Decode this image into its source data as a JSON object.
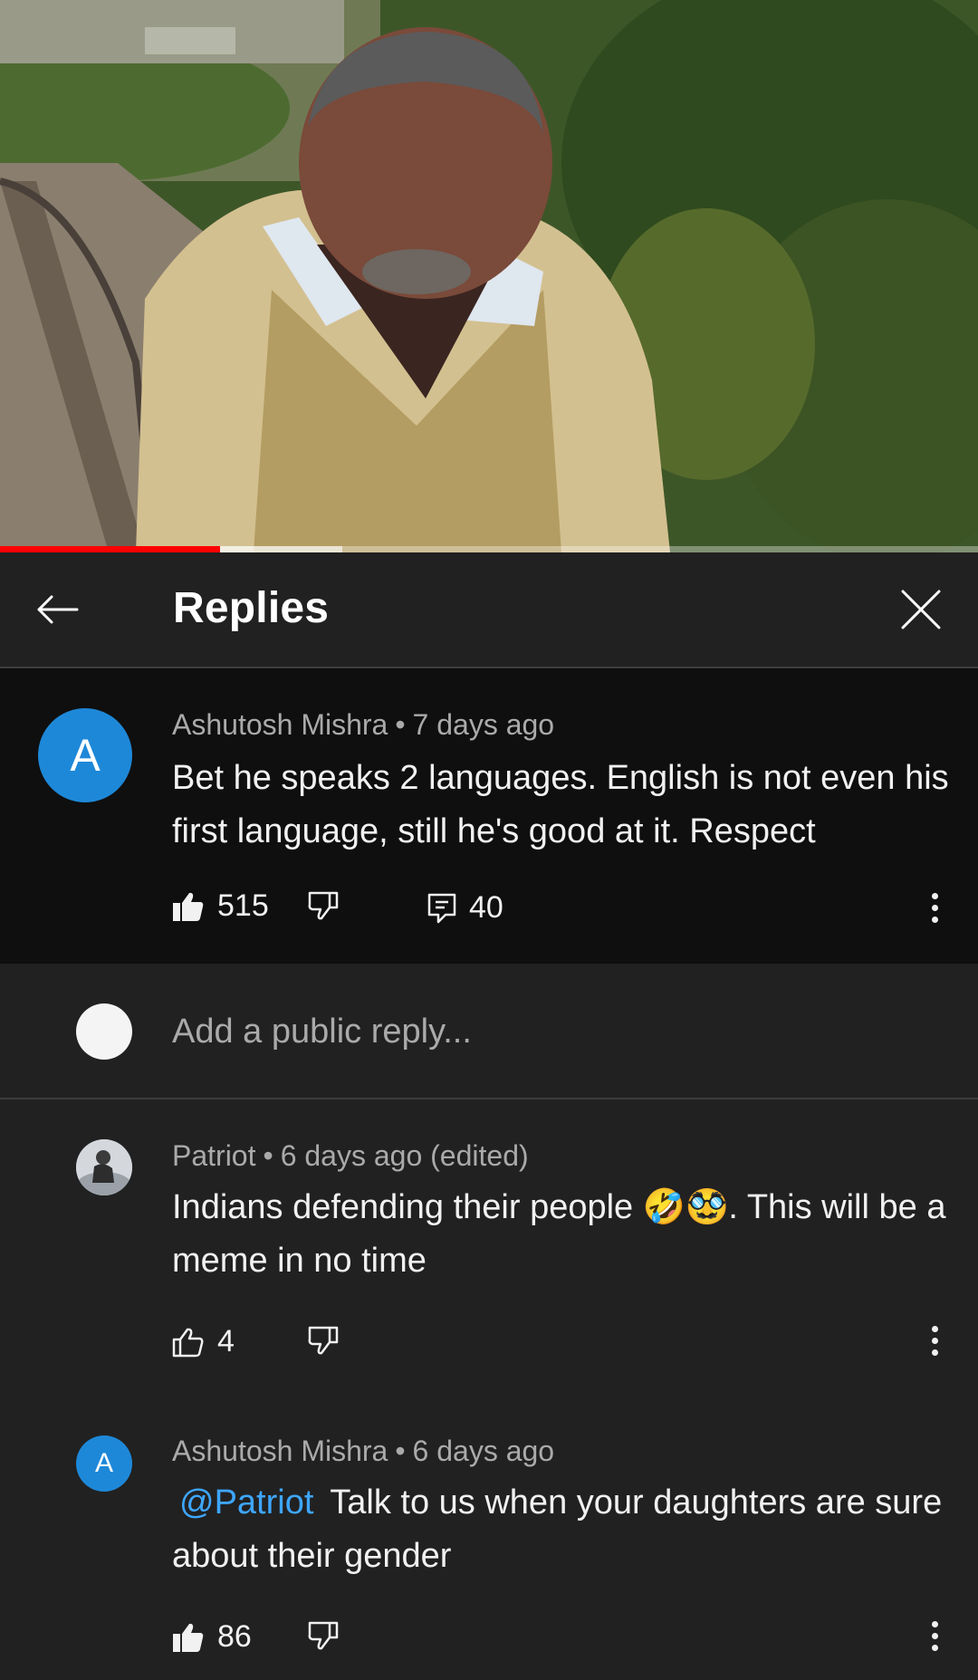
{
  "video": {
    "progress_played": 0.225,
    "progress_buffered": 0.35
  },
  "header": {
    "title": "Replies"
  },
  "main_comment": {
    "avatar_letter": "A",
    "author": "Ashutosh Mishra",
    "separator": "•",
    "time": "7 days ago",
    "text": "Bet he speaks 2 languages. English is not even his first language, still he's good at it. Respect",
    "likes": "515",
    "replies_count": "40"
  },
  "reply_input": {
    "placeholder": "Add a public reply..."
  },
  "replies": [
    {
      "author": "Patriot",
      "separator": "•",
      "time": "6 days ago (edited)",
      "text_before": "Indians defending their people ",
      "emojis": "🤣🥸",
      "text_after": ". This will be a meme in no time",
      "likes": "4"
    },
    {
      "avatar_letter": "A",
      "author": "Ashutosh Mishra",
      "separator": "•",
      "time": "6 days ago",
      "mention": "@Patriot",
      "text": "Talk to us when your daughters are sure about their gender",
      "likes": "86"
    }
  ],
  "colors": {
    "accent_red": "#ff0000",
    "avatar_blue": "#1e88d8",
    "mention_blue": "#3ea6ff"
  }
}
